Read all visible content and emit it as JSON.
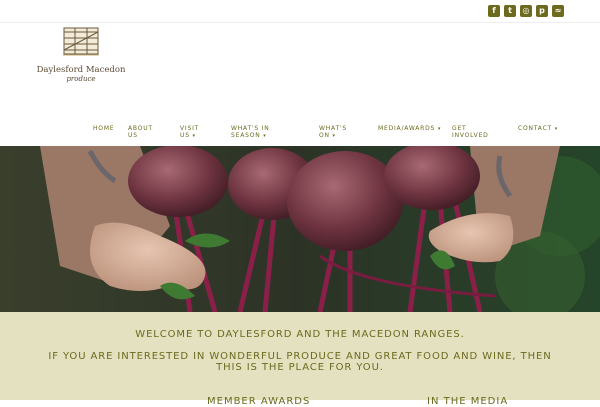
{
  "social": {
    "icons": [
      "facebook-icon",
      "twitter-icon",
      "instagram-icon",
      "pinterest-icon",
      "rss-icon"
    ]
  },
  "logo": {
    "name": "Daylesford Macedon",
    "sub": "produce"
  },
  "nav": {
    "items": [
      {
        "label": "HOME"
      },
      {
        "label": "ABOUT US"
      },
      {
        "label": "VISIT US"
      },
      {
        "label": "WHAT'S IN SEASON"
      },
      {
        "label": "WHAT'S ON"
      },
      {
        "label": "MEDIA/AWARDS"
      },
      {
        "label": "GET INVOLVED"
      },
      {
        "label": "CONTACT"
      }
    ]
  },
  "hero": {
    "image": "hands-holding-beetroots"
  },
  "welcome": {
    "line1": "WELCOME TO DAYLESFORD AND THE MACEDON RANGES.",
    "line2": "IF YOU ARE INTERESTED IN WONDERFUL PRODUCE AND GREAT FOOD AND WINE, THEN",
    "line3": "THIS IS THE PLACE FOR YOU.",
    "heading_left": "MEMBER AWARDS",
    "heading_right": "IN THE MEDIA"
  },
  "colors": {
    "accent": "#6b6a1e",
    "welcome_bg": "#e4e1c0"
  }
}
